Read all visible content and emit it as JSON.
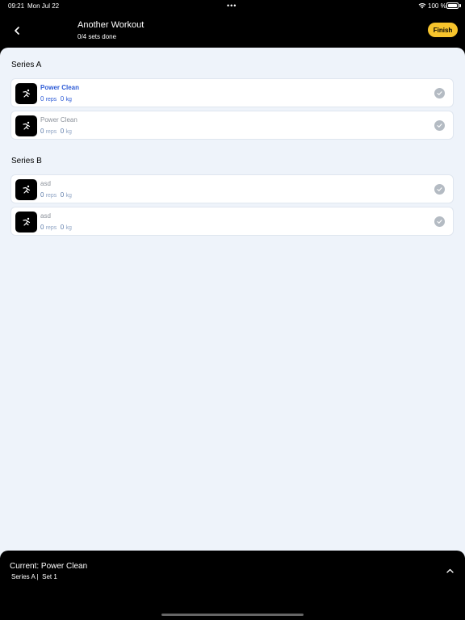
{
  "status": {
    "time": "09:21",
    "date": "Mon Jul 22",
    "dots": "•••",
    "battery": "100 %"
  },
  "header": {
    "back_icon": "chevron-left-icon",
    "title": "Another Workout",
    "subtitle": "0/4 sets done",
    "finish_label": "Finish",
    "finish_color": "#f7c42c"
  },
  "series": [
    {
      "title": "Series A",
      "exercises": [
        {
          "name": "Power Clean",
          "reps": "0",
          "reps_unit": "reps",
          "weight": "0",
          "weight_unit": "kg",
          "active": true,
          "icon": "exercise-figure-icon"
        },
        {
          "name": "Power Clean",
          "reps": "0",
          "reps_unit": "reps",
          "weight": "0",
          "weight_unit": "kg",
          "active": false,
          "icon": "exercise-figure-icon"
        }
      ]
    },
    {
      "title": "Series B",
      "exercises": [
        {
          "name": "asd",
          "reps": "0",
          "reps_unit": "reps",
          "weight": "0",
          "weight_unit": "kg",
          "active": false,
          "icon": "exercise-figure-icon"
        },
        {
          "name": "asd",
          "reps": "0",
          "reps_unit": "reps",
          "weight": "0",
          "weight_unit": "kg",
          "active": false,
          "icon": "exercise-figure-icon"
        }
      ]
    }
  ],
  "current": {
    "title": "Current: Power Clean",
    "series": "Series A",
    "separator": "|",
    "set": "Set 1"
  },
  "colors": {
    "accent": "#2d5bd6",
    "background": "#eef3fa"
  }
}
